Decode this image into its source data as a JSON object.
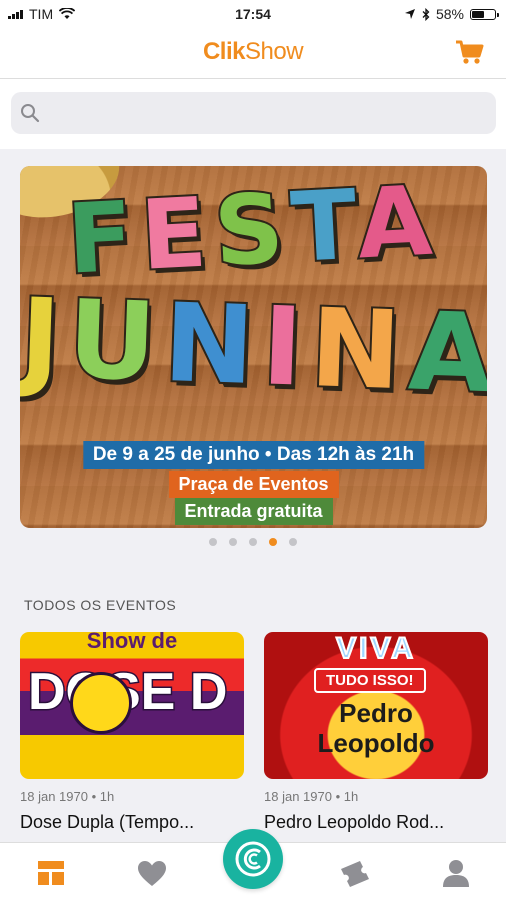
{
  "status_bar": {
    "carrier": "TIM",
    "time": "17:54",
    "battery": "58%"
  },
  "header": {
    "logo_part1": "Clik",
    "logo_part2": "Show"
  },
  "search": {
    "placeholder": ""
  },
  "banner": {
    "line1": "FESTA",
    "line2": "JUNINA",
    "date_text": "De 9 a 25 de junho • Das 12h às 21h",
    "location_text": "Praça de Eventos",
    "entry_text": "Entrada gratuita"
  },
  "carousel": {
    "page_count": 5,
    "active_page": 4
  },
  "events_section": {
    "title": "TODOS OS EVENTOS",
    "events": [
      {
        "date": "18 jan 1970 • 1h",
        "name": "Dose Dupla (Tempo...",
        "poster_top": "Show de",
        "poster_main": "DOSE D"
      },
      {
        "date": "18 jan 1970 • 1h",
        "name": "Pedro Leopoldo Rod...",
        "poster_top": "VIVA",
        "poster_banner": "TUDO ISSO!",
        "poster_name_line1": "Pedro",
        "poster_name_line2": "Leopoldo"
      }
    ]
  },
  "tab_bar": {
    "items": [
      "home-tab",
      "favorites-tab",
      "center-action",
      "tickets-tab",
      "profile-tab"
    ]
  },
  "colors": {
    "brand": "#f08c1e",
    "accent": "#19b3a0"
  }
}
